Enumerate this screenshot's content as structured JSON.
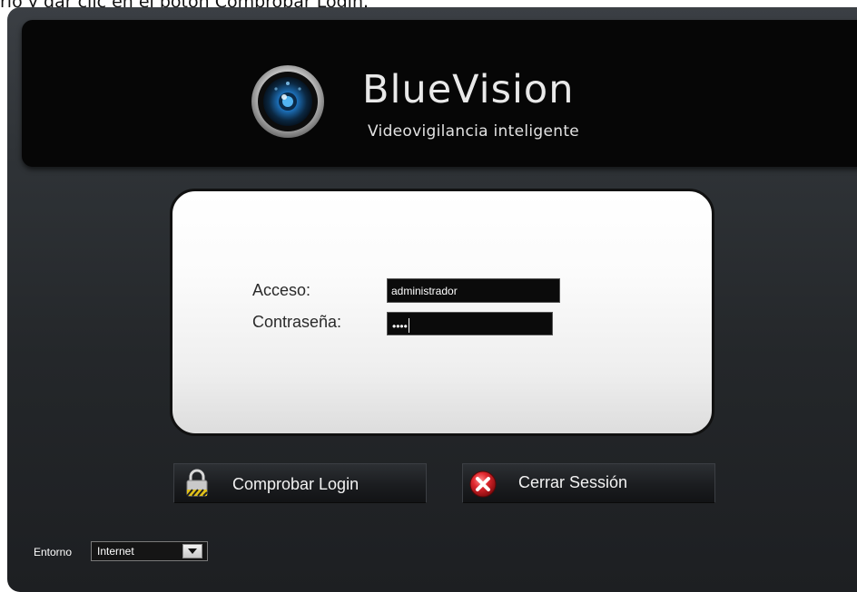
{
  "caption": {
    "text": "rio y dar clic en el botón Comprobar Login."
  },
  "header": {
    "brand_title": "BlueVision",
    "brand_subtitle": "Videovigilancia inteligente",
    "logo_icon": "camera-lens-icon"
  },
  "login_form": {
    "username_label": "Acceso:",
    "username_value": "administrador",
    "password_label": "Contraseña:",
    "password_value": "••••"
  },
  "actions": {
    "check_login_label": "Comprobar Login",
    "check_login_icon": "padlock-icon",
    "close_session_label": "Cerrar Sessión",
    "close_session_icon": "red-x-icon"
  },
  "environment": {
    "label": "Entorno",
    "selected": "Internet"
  },
  "colors": {
    "background": "#24272a",
    "header": "#060606",
    "card": "#f4f4f4",
    "lens_accent": "#2f8fd8",
    "close_accent": "#d8262b"
  }
}
